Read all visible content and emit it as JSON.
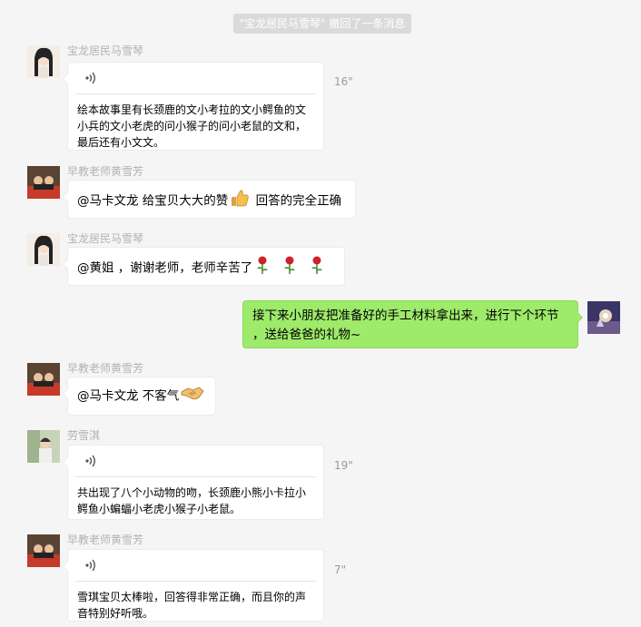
{
  "system_notice": "\"宝龙居民马雪琴\" 撤回了一条消息",
  "messages": [
    {
      "sender": "宝龙居民马雪琴",
      "duration": "16\"",
      "transcript": "绘本故事里有长颈鹿的文小考拉的文小鳄鱼的文小兵的文小老虎的问小猴子的问小老鼠的文和，最后还有小文文。"
    },
    {
      "sender": "早教老师黄雪芳",
      "text_a": "@马卡文龙 给宝贝大大的赞",
      "text_b": " 回答的完全正确"
    },
    {
      "sender": "宝龙居民马雪琴",
      "text": "@黄姐 ，谢谢老师，老师辛苦了"
    },
    {
      "text_line1": "接下来小朋友把准备好的手工材料拿出来，进行下个环节",
      "text_line2": "，送给爸爸的礼物~"
    },
    {
      "sender": "早教老师黄雪芳",
      "text": "@马卡文龙 不客气"
    },
    {
      "sender": "劳雪淇",
      "duration": "19\"",
      "transcript": "共出现了八个小动物的吻，长颈鹿小熊小卡拉小鳄鱼小蝙蝠小老虎小猴子小老鼠。"
    },
    {
      "sender": "早教老师黄雪芳",
      "duration": "7\"",
      "transcript": "雪琪宝贝太棒啦，回答得非常正确，而且你的声音特别好听哦。"
    }
  ],
  "icons": {
    "voice": "voice-wave-icon",
    "thumb": "thumbs-up-icon",
    "rose": "rose-icon",
    "handshake": "handshake-icon"
  }
}
